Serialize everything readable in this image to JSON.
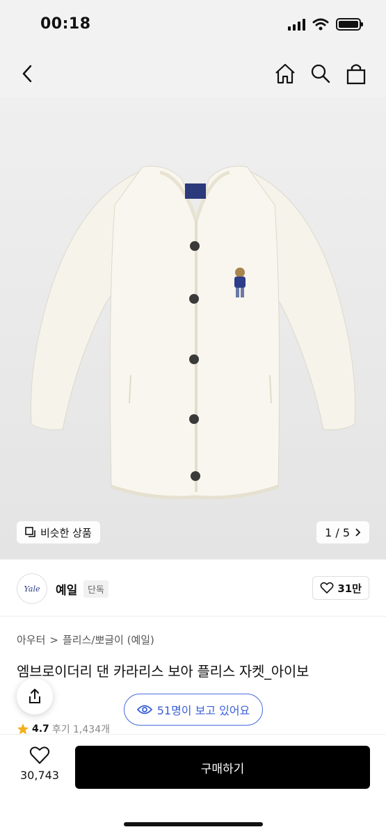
{
  "status": {
    "time": "00:18"
  },
  "header": {
    "icons": [
      "back-icon",
      "home-icon",
      "search-icon",
      "shopping-bag-icon"
    ]
  },
  "gallery": {
    "similar_label": "비슷한 상품",
    "page_indicator": "1 / 5"
  },
  "brand": {
    "logo_text": "Yale",
    "name": "예일",
    "tag": "단독",
    "likes": "31만"
  },
  "breadcrumb": {
    "category": "아우터",
    "separator": ">",
    "subcategory": "플리스/뽀글이 (예일)"
  },
  "product": {
    "title": "엠브로이더리 댄 카라리스 보아 플리스 자켓_아이보",
    "rating": "4.7",
    "reviews": "후기 1,434개"
  },
  "viewers": {
    "label": "51명이 보고 있어요"
  },
  "bottom": {
    "wish_count": "30,743",
    "buy_label": "구매하기"
  },
  "colors": {
    "accent_blue": "#3a5fd8",
    "buy_button": "#000000",
    "star": "#f2b01e"
  }
}
